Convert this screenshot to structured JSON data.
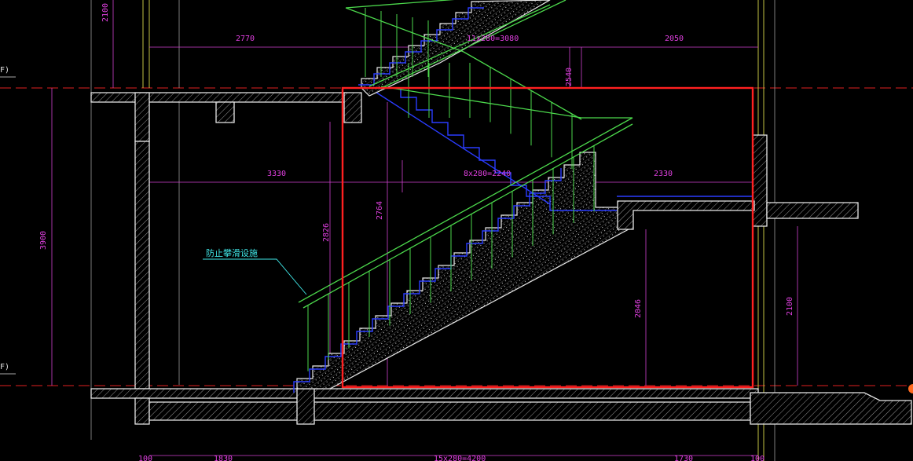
{
  "dimensions": {
    "top_left": "2770",
    "top_mid": "11x280=3080",
    "top_right": "2050",
    "top_vertical": "2100",
    "upper_flight_height": "2540",
    "mid_left": "3330",
    "mid_mid": "8x280=2240",
    "mid_right": "2330",
    "left_total_height": "3900",
    "flight_rise_a": "2826",
    "flight_rise_b": "2764",
    "headroom": "2046",
    "right_height": "2100",
    "bottom_left": "100",
    "bottom_a": "1830",
    "bottom_mid": "15x280=4200",
    "bottom_b": "1730",
    "bottom_right": "100"
  },
  "annotation": "防止攀滑设施",
  "level_marks": [
    "F)",
    "F)"
  ],
  "colors": {
    "background": "#000000",
    "dimension": "#e040e0",
    "handrail": "#4cd94c",
    "highlight_box": "#ff2020",
    "stair_outline": "#2a3cff",
    "note": "#40e8e8"
  }
}
